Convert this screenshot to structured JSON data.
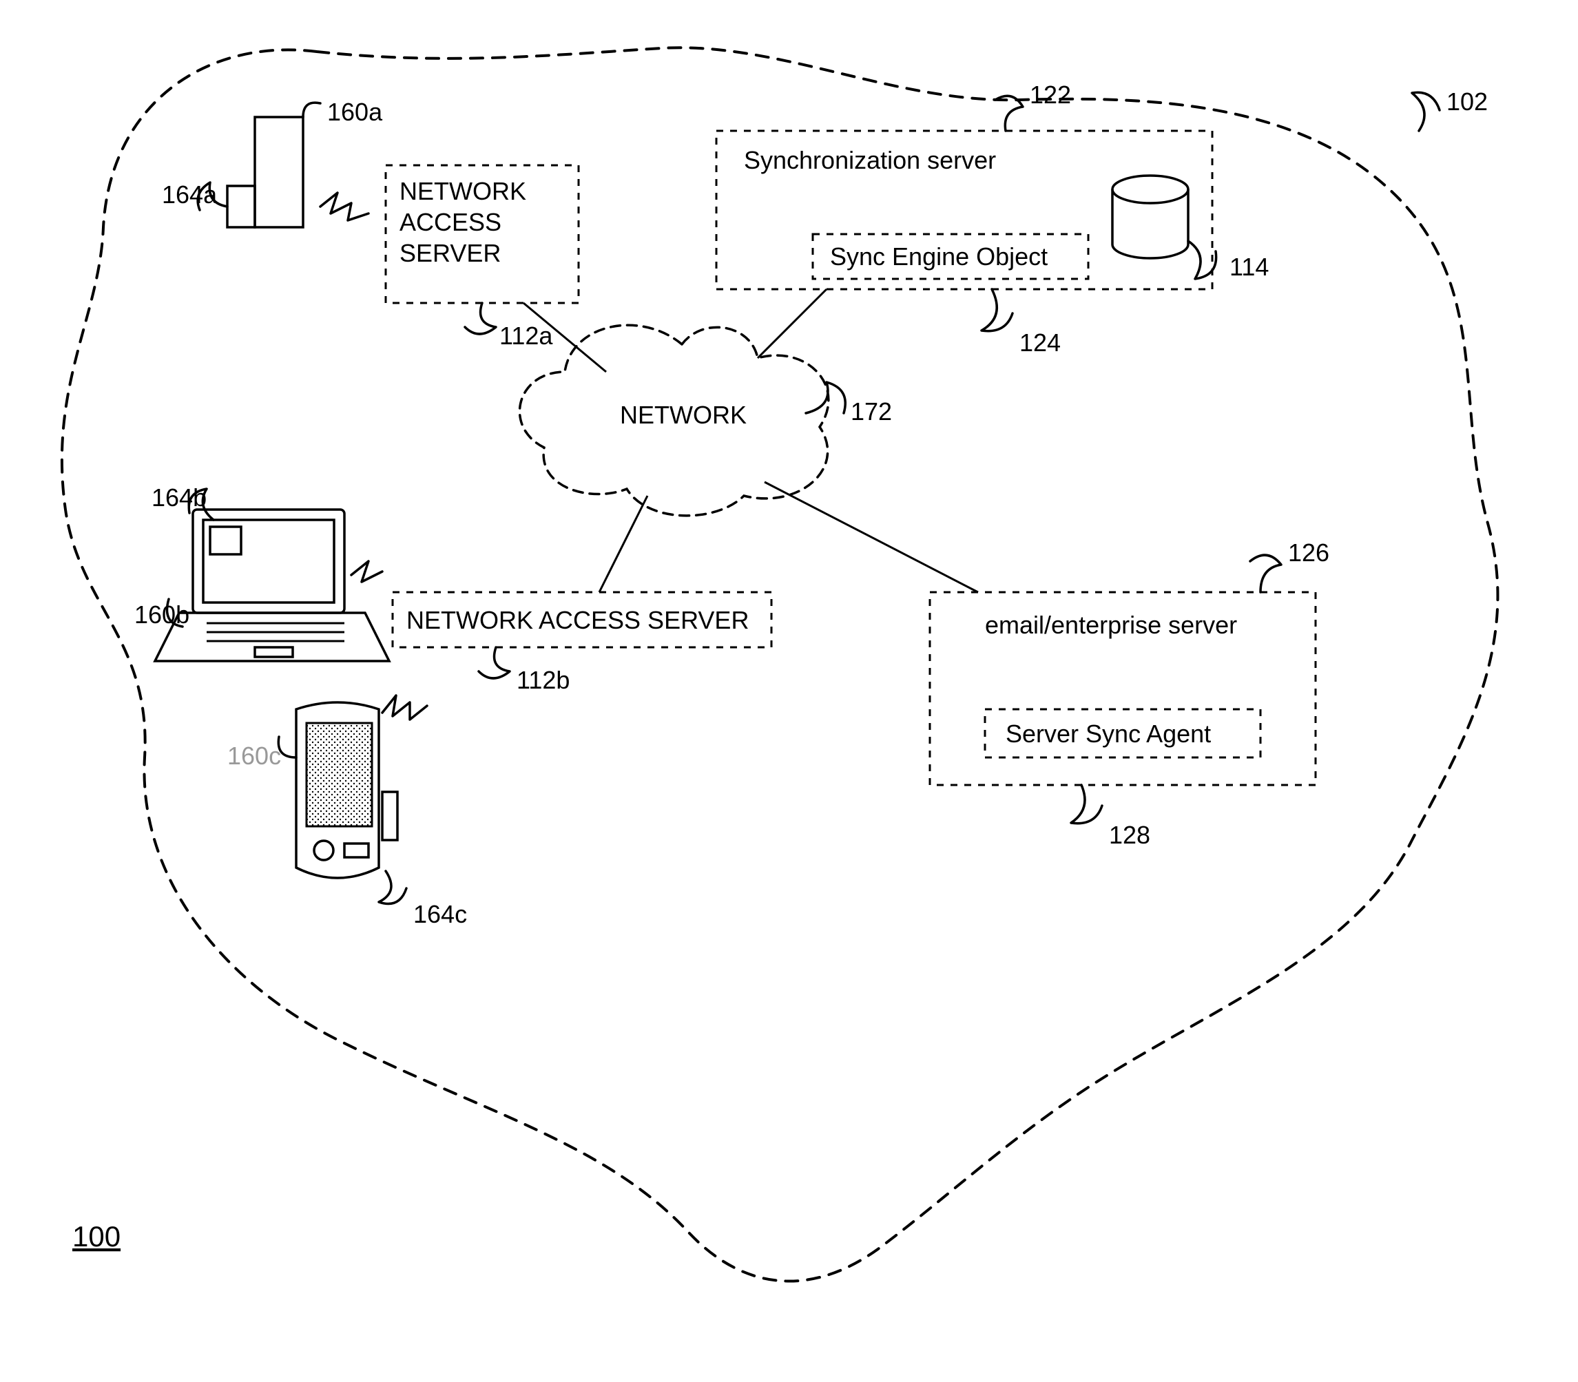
{
  "figure_number": "100",
  "boundary_ref": "102",
  "network_label": "NETWORK",
  "network_ref": "172",
  "nas1": {
    "line1": "NETWORK",
    "line2": "ACCESS",
    "line3": "SERVER",
    "ref": "112a"
  },
  "nas2": {
    "label": "NETWORK ACCESS SERVER",
    "ref": "112b"
  },
  "sync_server": {
    "title": "Synchronization server",
    "ref": "122",
    "engine_label": "Sync Engine Object",
    "engine_ref": "124",
    "db_ref": "114"
  },
  "email_server": {
    "title": "email/enterprise server",
    "ref": "126",
    "agent_label": "Server Sync Agent",
    "agent_ref": "128"
  },
  "devices": {
    "tower": {
      "device_ref": "160a",
      "app_ref": "164a"
    },
    "laptop": {
      "device_ref": "160b",
      "app_ref": "164b"
    },
    "pda": {
      "device_ref": "160c",
      "app_ref": "164c"
    }
  }
}
